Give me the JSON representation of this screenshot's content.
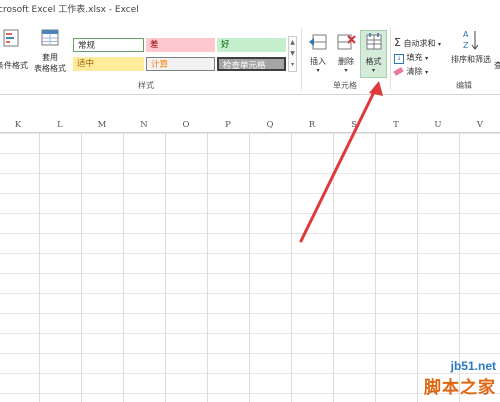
{
  "window": {
    "title": "crosoft Excel 工作表.xlsx - Excel"
  },
  "ribbon": {
    "styles_group": {
      "label": "样式",
      "conditional_format": "条件格式",
      "table_format_line1": "套用",
      "table_format_line2": "表格格式",
      "cell_styles": {
        "normal": "常规",
        "bad": "差",
        "good": "好",
        "neutral": "适中",
        "calculation": "计算",
        "check_cell": "检查单元格"
      }
    },
    "cells_group": {
      "label": "单元格",
      "insert": "插入",
      "delete": "删除",
      "format": "格式"
    },
    "editing_group": {
      "label": "编辑",
      "autosum": "自动求和",
      "fill": "填充",
      "clear": "清除",
      "sort_filter": "排序和筛选",
      "find_select_partial": "查"
    }
  },
  "sheet": {
    "columns": [
      "K",
      "L",
      "M",
      "N",
      "O",
      "P",
      "Q",
      "R",
      "S",
      "T",
      "U",
      "V"
    ]
  },
  "watermark": {
    "url": "jb51.net",
    "name": "脚本之家"
  },
  "colors": {
    "arrow": "#e0393a",
    "format_highlight": "#d5ebd9"
  }
}
